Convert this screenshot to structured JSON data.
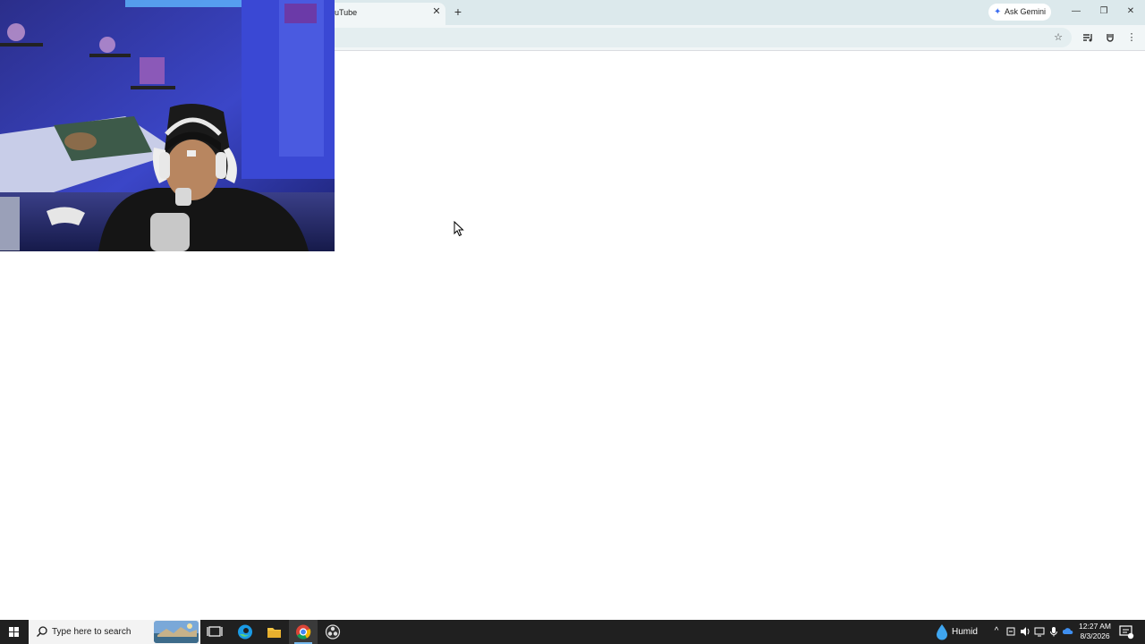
{
  "browser": {
    "tab_title": "uTube",
    "tab_close_icon": "close-icon",
    "new_tab_icon": "plus-icon",
    "gemini_label": "Ask Gemini",
    "window_controls": [
      "minimize-icon",
      "restore-icon",
      "close-icon"
    ],
    "toolbar_icons": [
      "star-icon",
      "media-controls-icon",
      "extension-icon",
      "more-vert-icon"
    ]
  },
  "taskbar": {
    "search_placeholder": "Type here to search",
    "apps": [
      "task-view-icon",
      "edge-icon",
      "file-explorer-icon",
      "chrome-icon",
      "obs-icon"
    ],
    "active_app": "chrome-icon",
    "weather": "Humid",
    "time": "12:27 AM",
    "date": "8/3/2026"
  },
  "colors": {
    "tabstrip": "#dce9ec",
    "toolbar": "#f1f6f7",
    "taskbar": "#202020",
    "webcam_wall": "#2a2fa0",
    "accent": "#76b9ed"
  }
}
